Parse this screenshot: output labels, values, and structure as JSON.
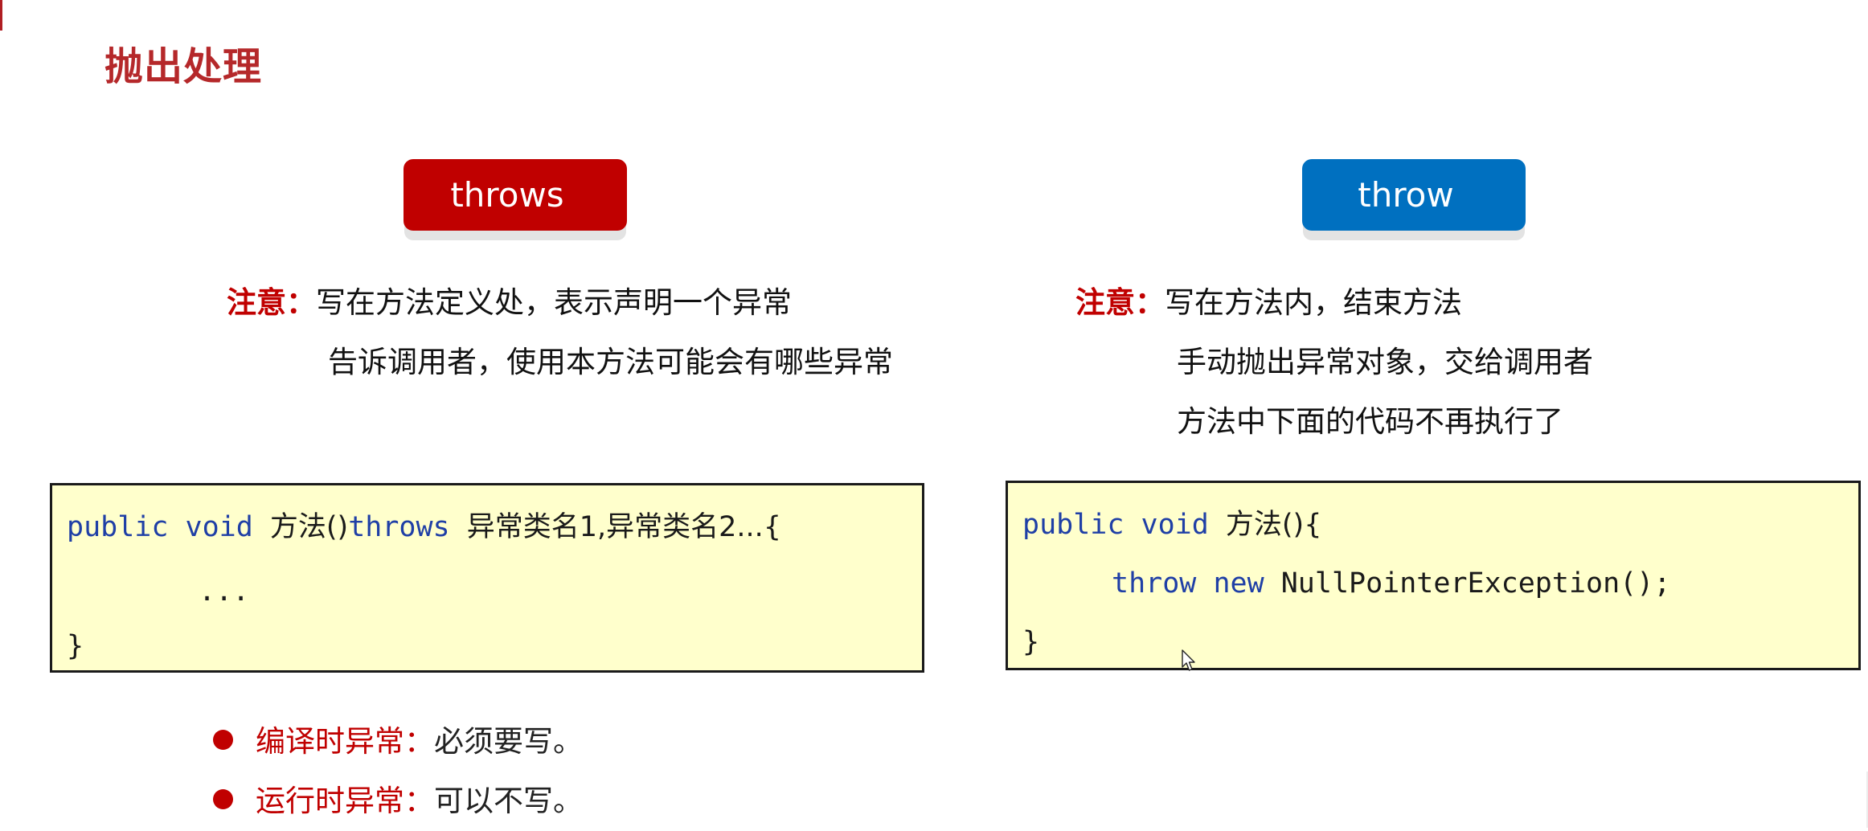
{
  "slide": {
    "title": "抛出处理",
    "colors": {
      "title": "#B5282A",
      "accent_red": "#C00000",
      "accent_blue": "#0070C0",
      "code_background": "#FFFFCC",
      "code_keyword": "#1F3FA6"
    }
  },
  "left": {
    "tag": "throws",
    "note_lead": "注意：",
    "note_lines": [
      "写在方法定义处，表示声明一个异常",
      "告诉调用者，使用本方法可能会有哪些异常"
    ],
    "code": {
      "line1": {
        "kw1": "public",
        "kw2": "void",
        "name": "方法()",
        "kw3": "throws",
        "rest": "异常类名1,异常类名2...{"
      },
      "line2": "...",
      "line3": "}"
    }
  },
  "right": {
    "tag": "throw",
    "note_lead": "注意：",
    "note_lines": [
      "写在方法内，结束方法",
      "手动抛出异常对象，交给调用者",
      "方法中下面的代码不再执行了"
    ],
    "code": {
      "line1": {
        "kw1": "public",
        "kw2": "void",
        "rest": "方法(){"
      },
      "line2": {
        "kw1": "throw",
        "kw2": "new",
        "rest": "NullPointerException();"
      },
      "line3": "}"
    }
  },
  "bullets": [
    {
      "label": "编译时异常：",
      "value": "必须要写。"
    },
    {
      "label": "运行时异常：",
      "value": "可以不写。"
    }
  ],
  "icons": {
    "cursor": "mouse-pointer-icon",
    "bullet": "filled-circle-bullet-icon"
  }
}
